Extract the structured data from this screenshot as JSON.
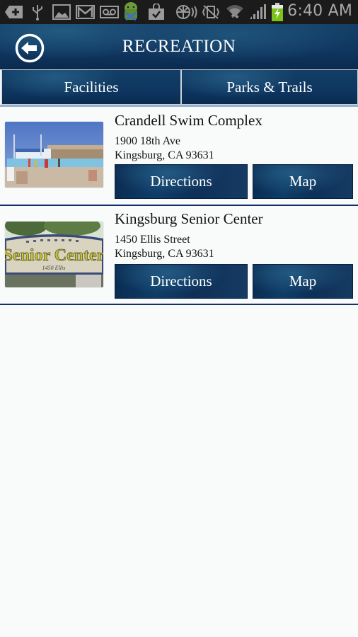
{
  "status_bar": {
    "icons": [
      "add-icon",
      "usb-icon",
      "gallery-icon",
      "gmail-icon",
      "voicemail-icon",
      "android-icon",
      "shopping-bag-check-icon",
      "nfc-icon",
      "vibrate-mute-icon",
      "wifi-icon",
      "signal-icon",
      "battery-charging-icon"
    ],
    "time": "6:40 AM",
    "battery_color": "#7cc319"
  },
  "header": {
    "title": "RECREATION",
    "back_icon": "back-arrow-circle-icon"
  },
  "tabs": [
    {
      "label": "Facilities"
    },
    {
      "label": "Parks & Trails"
    }
  ],
  "facilities": [
    {
      "name": "Crandell Swim Complex",
      "address_line1": "1900 18th Ave",
      "address_line2": "Kingsburg, CA 93631",
      "directions_label": "Directions",
      "map_label": "Map",
      "image": "swimming-pool-photo"
    },
    {
      "name": "Kingsburg Senior Center",
      "address_line1": "1450 Ellis Street",
      "address_line2": "Kingsburg, CA 93631",
      "directions_label": "Directions",
      "map_label": "Map",
      "image": "senior-center-sign-photo",
      "sign_text": "Senior Center",
      "sign_subtext": "1450 Ellis"
    }
  ],
  "colors": {
    "brand_navy": "#0f3660",
    "divider": "#14306a",
    "background": "#f9fbfb"
  }
}
